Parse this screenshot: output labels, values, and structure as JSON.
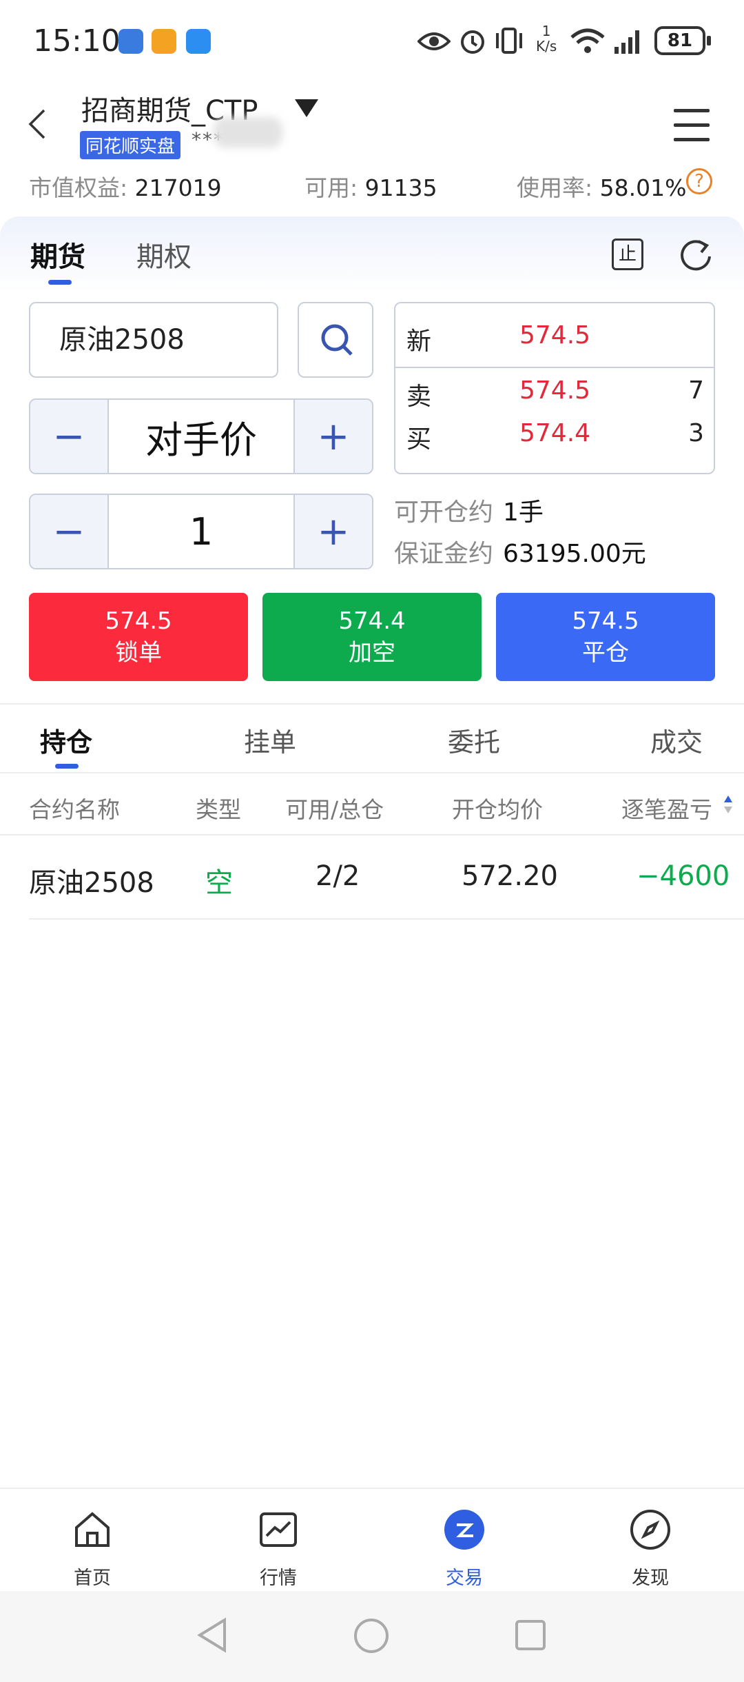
{
  "status_bar": {
    "time": "15:10",
    "net_speed_top": "1",
    "net_speed_unit": "K/s",
    "battery": "81",
    "icons": [
      "app-icon-1",
      "app-icon-2",
      "weather-icon",
      "eye-icon",
      "alarm-icon",
      "vibrate-icon",
      "wifi-icon",
      "signal-icon",
      "battery-icon"
    ]
  },
  "header": {
    "title": "招商期货_CTP",
    "badge": "同花顺实盘",
    "account": "***"
  },
  "summary": {
    "equity_label": "市值权益:",
    "equity_value": "217019",
    "available_label": "可用:",
    "available_value": "91135",
    "usage_label": "使用率:",
    "usage_value": "58.01%",
    "help": "?"
  },
  "top_tabs": [
    "期货",
    "期权"
  ],
  "contract_input": "原油2508",
  "price_stepper": {
    "minus": "−",
    "value": "对手价",
    "plus": "+"
  },
  "qty_stepper": {
    "minus": "−",
    "value": "1",
    "plus": "+"
  },
  "quote": {
    "new_label": "新",
    "new_value": "574.5",
    "sell_label": "卖",
    "sell_value": "574.5",
    "sell_vol": "7",
    "buy_label": "买",
    "buy_value": "574.4",
    "buy_vol": "3"
  },
  "info": {
    "openable_label": "可开仓约",
    "openable_value": "1手",
    "margin_label": "保证金约",
    "margin_value": "63195.00元"
  },
  "stop_icon": "止",
  "actions": [
    {
      "price": "574.5",
      "label": "锁单",
      "color": "#fb2a3c"
    },
    {
      "price": "574.4",
      "label": "加空",
      "color": "#0daa4e"
    },
    {
      "price": "574.5",
      "label": "平仓",
      "color": "#3a6af5"
    }
  ],
  "bottom_tabs": [
    "持仓",
    "挂单",
    "委托",
    "成交"
  ],
  "table": {
    "headers": [
      "合约名称",
      "类型",
      "可用/总仓",
      "开仓均价",
      "逐笔盈亏"
    ],
    "rows": [
      {
        "name": "原油2508",
        "type": "空",
        "avail": "2/2",
        "avg": "572.20",
        "pnl": "−4600"
      }
    ]
  },
  "nav": [
    "首页",
    "行情",
    "交易",
    "发现"
  ]
}
